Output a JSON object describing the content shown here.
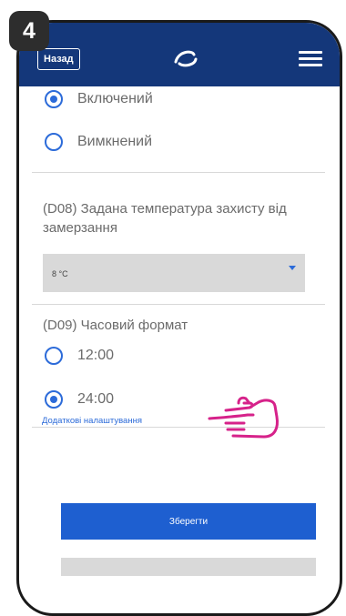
{
  "step": {
    "number": "4"
  },
  "header": {
    "back_label": "Назад",
    "logo_icon": "salus-logo-icon",
    "menu_icon": "hamburger-menu-icon",
    "background_color": "#14377a"
  },
  "section_status": {
    "options": [
      {
        "label": "Включений",
        "checked": true
      },
      {
        "label": "Вимкнений",
        "checked": false
      }
    ]
  },
  "section_d08": {
    "label": "(D08) Задана температура захисту від замерзання",
    "selected_value": "8 °C"
  },
  "section_d09": {
    "label": "(D09) Часовий формат",
    "options": [
      {
        "label": "12:00",
        "checked": false
      },
      {
        "label": "24:00",
        "checked": true
      }
    ]
  },
  "more_settings_label": "Додаткові налаштування",
  "save_label": "Зберегти",
  "accent_color": "#2c6bd9",
  "pointer_icon": "pointing-hand-icon",
  "pointer_color": "#d6228a"
}
